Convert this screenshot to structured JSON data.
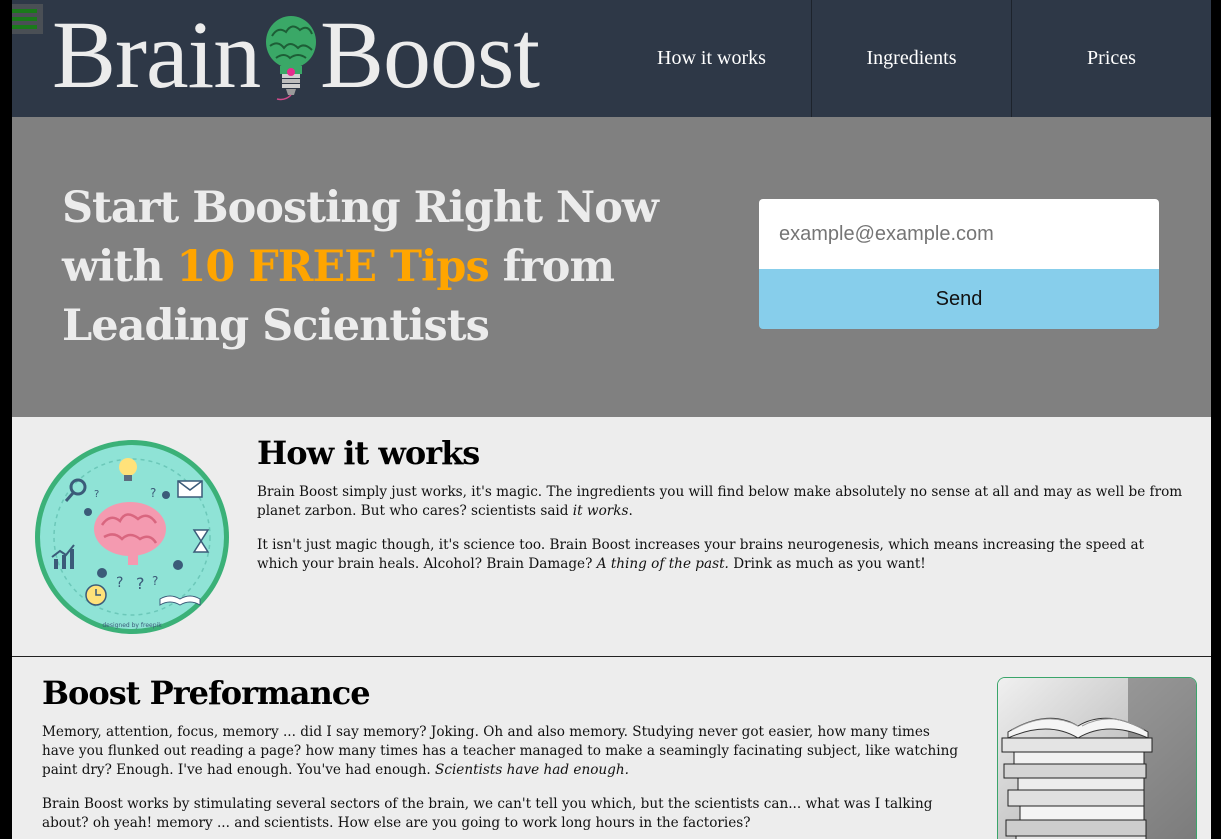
{
  "header": {
    "logo_left": "Brain",
    "logo_right": "Boost",
    "nav": [
      {
        "label": "How it works"
      },
      {
        "label": "Ingredients"
      },
      {
        "label": "Prices"
      }
    ]
  },
  "hero": {
    "title_part1": "Start Boosting Right Now with ",
    "title_highlight": "10 FREE Tips",
    "title_part2": " from Leading Scientists",
    "email_placeholder": "example@example.com",
    "send_label": "Send"
  },
  "how": {
    "title": "How it works",
    "p1_text": "Brain Boost simply just works, it's magic. The ingredients you will find below make absolutely no sense at all and may as well be from planet zarbon. But who cares? scientists said ",
    "p1_em": "it works",
    "p1_end": ".",
    "p2_text": "It isn't just magic though, it's science too. Brain Boost increases your brains neurogenesis, which means increasing the speed at which your brain heals. Alcohol? Brain Damage? ",
    "p2_em": "A thing of the past.",
    "p2_end": " Drink as much as you want!",
    "image_credit": "designed by freepik"
  },
  "boost": {
    "title": "Boost Preformance",
    "p1_text": "Memory, attention, focus, memory ... did I say memory? Joking. Oh and also memory. Studying never got easier, how many times have you flunked out reading a page? how many times has a teacher managed to make a seamingly facinating subject, like watching paint dry? Enough. I've had enough. You've had enough. ",
    "p1_em": "Scientists have had enough.",
    "p2_text": "Brain Boost works by stimulating several sectors of the brain, we can't tell you which, but the scientists can... what was I talking about? oh yeah! memory ... and scientists. How else are you going to work long hours in the factories?"
  },
  "colors": {
    "header_bg": "#2e3847",
    "hero_bg": "#808080",
    "highlight": "#ffa500",
    "send_bg": "#87ceeb",
    "menu_icon": "#1a7a1a"
  },
  "icons": [
    "menu-icon",
    "lightbulb-brain-logo-icon"
  ]
}
